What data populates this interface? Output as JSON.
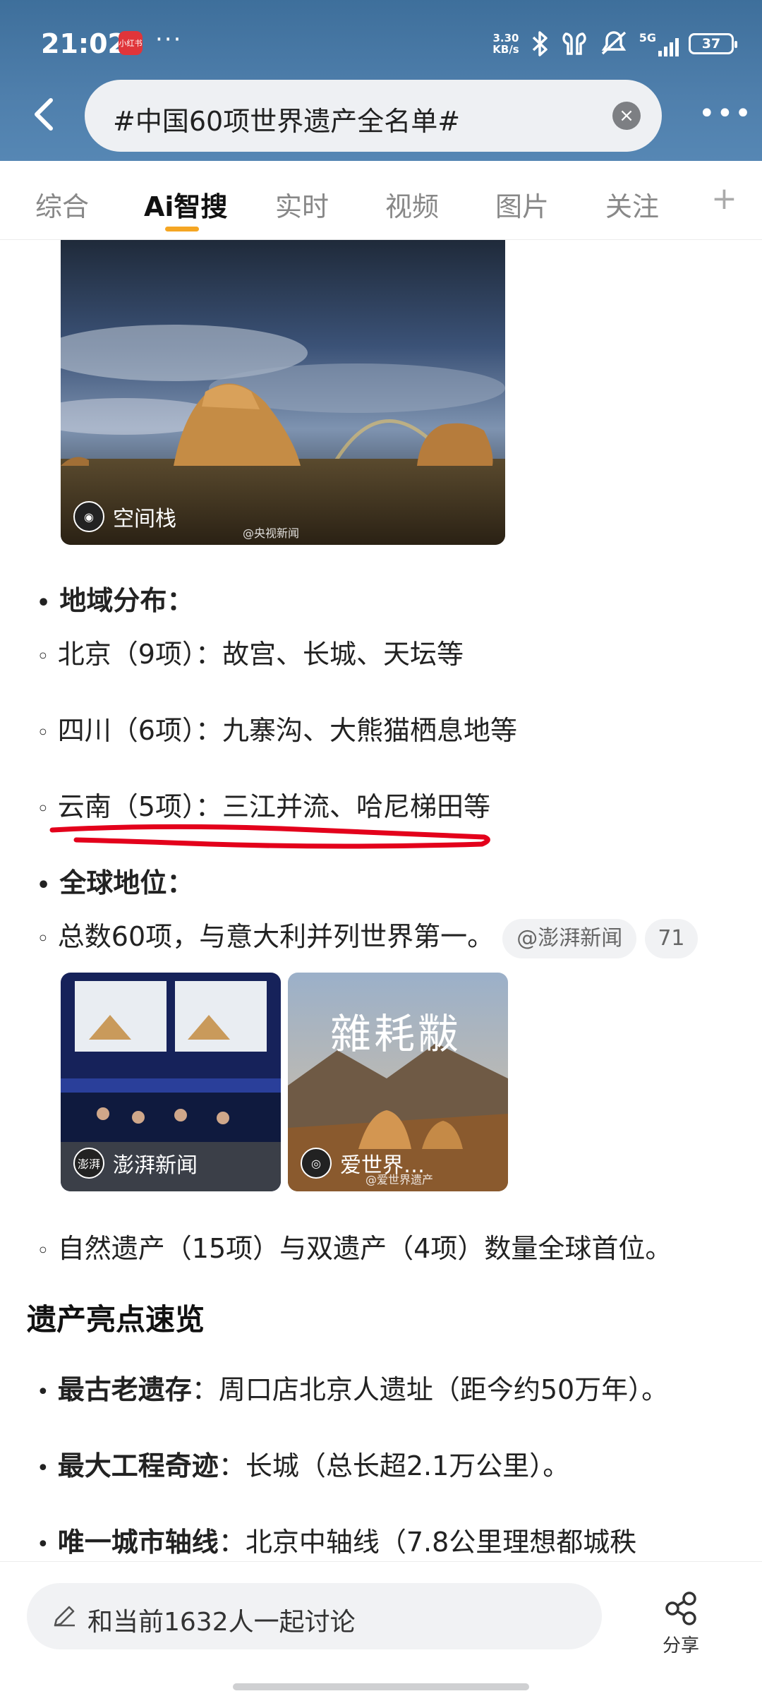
{
  "status_bar": {
    "time": "21:02",
    "app_badge": "小红书",
    "more": "···",
    "net_speed": "3.30\nKB/s",
    "signal": "5G",
    "battery": "37"
  },
  "header": {
    "search_query": "#中国60项世界遗产全名单#",
    "clear": "×",
    "more": "•••"
  },
  "tabs": [
    "综合",
    "Ai智搜",
    "实时",
    "视频",
    "图片",
    "关注"
  ],
  "active_tab": "Ai智搜",
  "image1": {
    "caption": "空间栈",
    "watermark": "@央视新闻"
  },
  "region": {
    "heading": "地域分布",
    "items": [
      "北京（9项）：故宫、长城、天坛等",
      "四川（6项）：九寨沟、大熊猫栖息地等",
      "云南（5项）：三江并流、哈尼梯田等"
    ]
  },
  "global": {
    "heading": "全球地位",
    "item1": "总数60项，与意大利并列世界第一。",
    "source": "@澎湃新闻",
    "source_count": "71",
    "item2": "自然遗产（15项）与双遗产（4项）数量全球首位。"
  },
  "image2": {
    "caption": "澎湃新闻",
    "avatar": "澎湃"
  },
  "image3": {
    "caption": "爱世界…",
    "overlay_text": "雜耗黻",
    "watermark": "@爱世界遗产"
  },
  "highlights": {
    "title": "遗产亮点速览",
    "items": [
      {
        "label": "最古老遗存",
        "text": "周口店北京人遗址（距今约50万年）。"
      },
      {
        "label": "最大工程奇迹",
        "text": "长城（总长超2.1万公里）。"
      },
      {
        "label": "唯一城市轴线",
        "text": "北京中轴线（7.8公里理想都城秩"
      }
    ]
  },
  "bottom_bar": {
    "discuss": "和当前1632人一起讨论",
    "share": "分享"
  },
  "colors": {
    "header": "#4f7fac",
    "accent": "#f5a623",
    "annotation": "#e3001b"
  }
}
